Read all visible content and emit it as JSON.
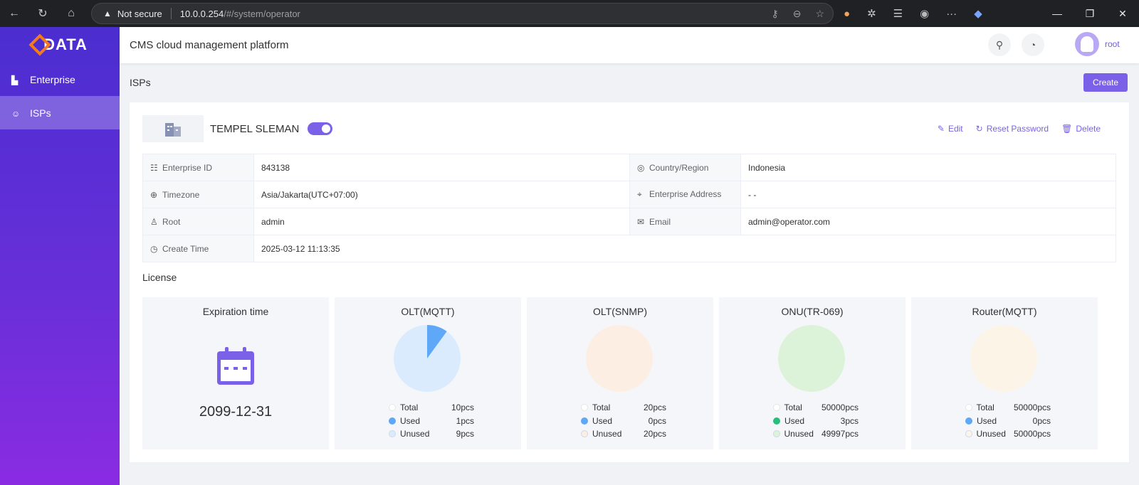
{
  "browser": {
    "security": "Not secure",
    "url_host": "10.0.0.254",
    "url_path": "/#/system/operator"
  },
  "sidebar": {
    "logo": "DATA",
    "items": [
      {
        "label": "Enterprise"
      },
      {
        "label": "ISPs"
      }
    ]
  },
  "header": {
    "title": "CMS cloud management platform",
    "user": "root"
  },
  "page": {
    "title": "ISPs",
    "create_label": "Create"
  },
  "enterprise": {
    "name": "TEMPEL SLEMAN",
    "enabled": true,
    "actions": {
      "edit": "Edit",
      "reset": "Reset Password",
      "delete": "Delete"
    },
    "fields": {
      "id_label": "Enterprise ID",
      "id": "843138",
      "country_label": "Country/Region",
      "country": "Indonesia",
      "tz_label": "Timezone",
      "tz": "Asia/Jakarta(UTC+07:00)",
      "addr_label": "Enterprise Address",
      "addr": "- -",
      "root_label": "Root",
      "root": "admin",
      "email_label": "Email",
      "email": "admin@operator.com",
      "ctime_label": "Create Time",
      "ctime": "2025-03-12 11:13:35"
    }
  },
  "license": {
    "title": "License",
    "expiration": {
      "label": "Expiration time",
      "date": "2099-12-31"
    },
    "total_label": "Total",
    "used_label": "Used",
    "unused_label": "Unused",
    "cards": [
      {
        "name": "OLT(MQTT)",
        "total": "10pcs",
        "used": "1pcs",
        "unused": "9pcs",
        "used_n": 1,
        "total_n": 10,
        "color": "#5ea8f7",
        "bg": "#d9ebfd"
      },
      {
        "name": "OLT(SNMP)",
        "total": "20pcs",
        "used": "0pcs",
        "unused": "20pcs",
        "used_n": 0,
        "total_n": 20,
        "color": "#5ea8f7",
        "bg": "#fdeee3"
      },
      {
        "name": "ONU(TR-069)",
        "total": "50000pcs",
        "used": "3pcs",
        "unused": "49997pcs",
        "used_n": 3,
        "total_n": 50000,
        "color": "#27c07a",
        "bg": "#ddf3d9"
      },
      {
        "name": "Router(MQTT)",
        "total": "50000pcs",
        "used": "0pcs",
        "unused": "50000pcs",
        "used_n": 0,
        "total_n": 50000,
        "color": "#5ea8f7",
        "bg": "#fdf4e8"
      }
    ]
  }
}
